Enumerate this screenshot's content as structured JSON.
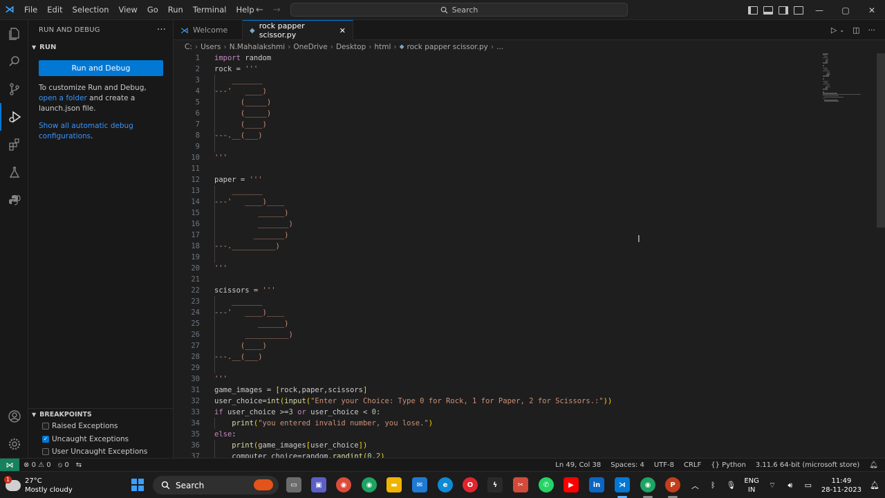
{
  "titlebar": {
    "menu": [
      "File",
      "Edit",
      "Selection",
      "View",
      "Go",
      "Run",
      "Terminal",
      "Help"
    ],
    "search_label": "Search"
  },
  "sidebar": {
    "header": "RUN AND DEBUG",
    "run_section": "RUN",
    "run_button": "Run and Debug",
    "customize_prefix": "To customize Run and Debug, ",
    "customize_link": "open a folder",
    "customize_suffix": " and create a launch.json file.",
    "automatic_link": "Show all automatic debug configurations",
    "automatic_suffix": ".",
    "breakpoints_header": "BREAKPOINTS",
    "breakpoints": [
      {
        "label": "Raised Exceptions",
        "checked": false
      },
      {
        "label": "Uncaught Exceptions",
        "checked": true
      },
      {
        "label": "User Uncaught Exceptions",
        "checked": false
      }
    ]
  },
  "tabs": [
    {
      "label": "Welcome",
      "active": false
    },
    {
      "label": "rock papper scissor.py",
      "active": true
    }
  ],
  "breadcrumb": [
    "C:",
    "Users",
    "N.Mahalakshmi",
    "OneDrive",
    "Desktop",
    "html",
    "rock papper scissor.py",
    "..."
  ],
  "code_lines": [
    "import random",
    "rock = '''",
    "    _______",
    "---'   ____)",
    "      (_____)",
    "      (_____)",
    "      (____)",
    "---.__(___)",
    "",
    "'''",
    "",
    "paper = '''",
    "    _______",
    "---'   ____)____",
    "          ______)",
    "          _______)",
    "         _______)",
    "---.__________)",
    "",
    "'''",
    "",
    "scissors = '''",
    "    _______",
    "---'   ____)____",
    "          ______)",
    "       __________)",
    "      (____)",
    "---.__(___)",
    "",
    "'''",
    "game_images = [rock,paper,scissors]",
    "user_choice=int(input(\"Enter your Choice: Type 0 for Rock, 1 for Paper, 2 for Scissors.:\"))",
    "if user_choice >=3 or user_choice < 0:",
    "    print(\"you entered invalid number, you lose.\")",
    "else:",
    "    print(game_images[user_choice])",
    "    computer_choice=random.randint(0,2)"
  ],
  "statusbar": {
    "errors": "0",
    "warnings": "0",
    "ports": "0",
    "cursor": "Ln 49, Col 38",
    "spaces": "Spaces: 4",
    "encoding": "UTF-8",
    "eol": "CRLF",
    "language": "Python",
    "interpreter": "3.11.6 64-bit (microsoft store)"
  },
  "taskbar": {
    "weather_badge": "1",
    "temperature": "27°C",
    "weather": "Mostly cloudy",
    "search": "Search",
    "language_top": "ENG",
    "language_bottom": "IN",
    "time": "11:49",
    "date": "28-11-2023"
  },
  "colors": {
    "accent": "#0078d4",
    "remote": "#16825d",
    "keyword": "#c586c0",
    "function": "#dcdcaa",
    "string": "#ce9178",
    "number": "#b5cea8"
  }
}
